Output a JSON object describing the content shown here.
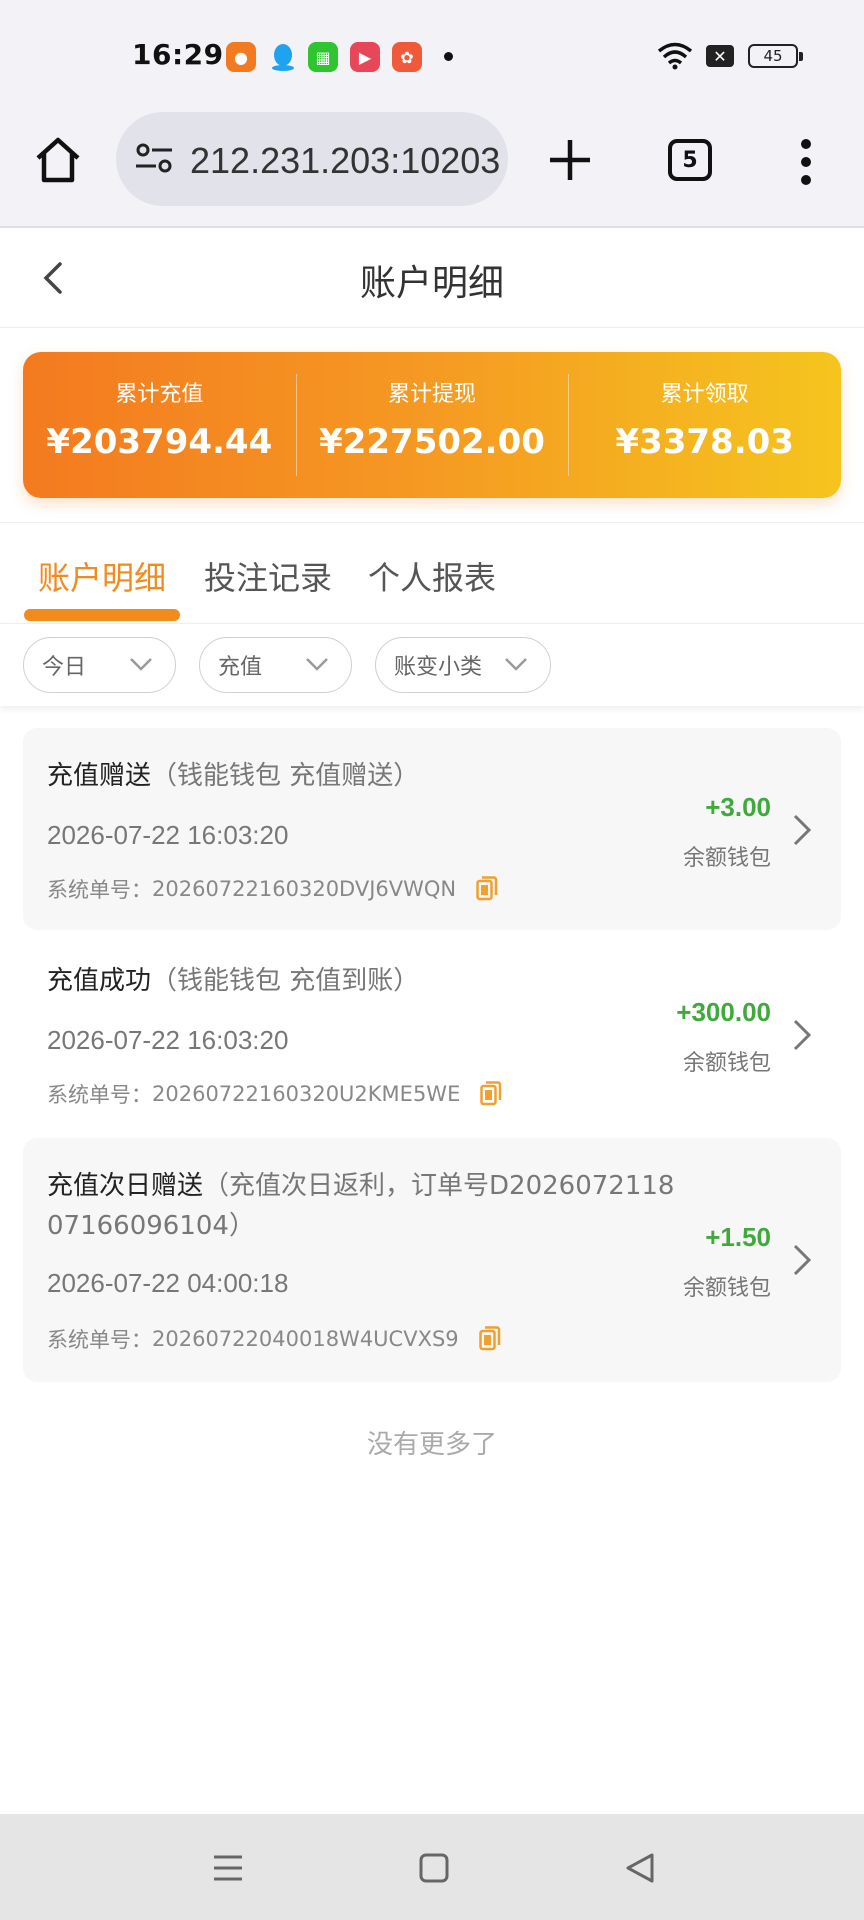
{
  "status_bar": {
    "time": "16:29",
    "apps": [
      "app-icon-1",
      "qq-icon",
      "app-icon-3",
      "video-icon",
      "app-icon-5"
    ],
    "battery": "45"
  },
  "browser": {
    "url": "212.231.203:10203",
    "tab_count": "5"
  },
  "header": {
    "title": "账户明细"
  },
  "summary": [
    {
      "label": "累计充值",
      "value": "¥203794.44"
    },
    {
      "label": "累计提现",
      "value": "¥227502.00"
    },
    {
      "label": "累计领取",
      "value": "¥3378.03"
    }
  ],
  "tabs": [
    {
      "label": "账户明细",
      "active": true
    },
    {
      "label": "投注记录",
      "active": false
    },
    {
      "label": "个人报表",
      "active": false
    }
  ],
  "filters": [
    {
      "value": "今日"
    },
    {
      "value": "充值"
    },
    {
      "value": "账变小类"
    }
  ],
  "records": [
    {
      "title": "充值赠送",
      "desc": "（钱能钱包 充值赠送）",
      "time": "2026-07-22 16:03:20",
      "order_label": "系统单号：",
      "order_no": "20260722160320DVJ6VWQN",
      "amount": "+3.00",
      "wallet": "余额钱包"
    },
    {
      "title": "充值成功",
      "desc": "（钱能钱包 充值到账）",
      "time": "2026-07-22 16:03:20",
      "order_label": "系统单号：",
      "order_no": "20260722160320U2KME5WE",
      "amount": "+300.00",
      "wallet": "余额钱包"
    },
    {
      "title": "充值次日赠送",
      "desc": "（充值次日返利，订单号D2026072118071660961​04）",
      "time": "2026-07-22 04:00:18",
      "order_label": "系统单号：",
      "order_no": "20260722040018W4UCVXS9",
      "amount": "+1.50",
      "wallet": "余额钱包"
    }
  ],
  "footer": {
    "no_more": "没有更多了"
  },
  "colors": {
    "accent": "#f38a1d",
    "positive": "#3fa93b",
    "gradient_start": "#f47a20",
    "gradient_end": "#f5c51e"
  }
}
